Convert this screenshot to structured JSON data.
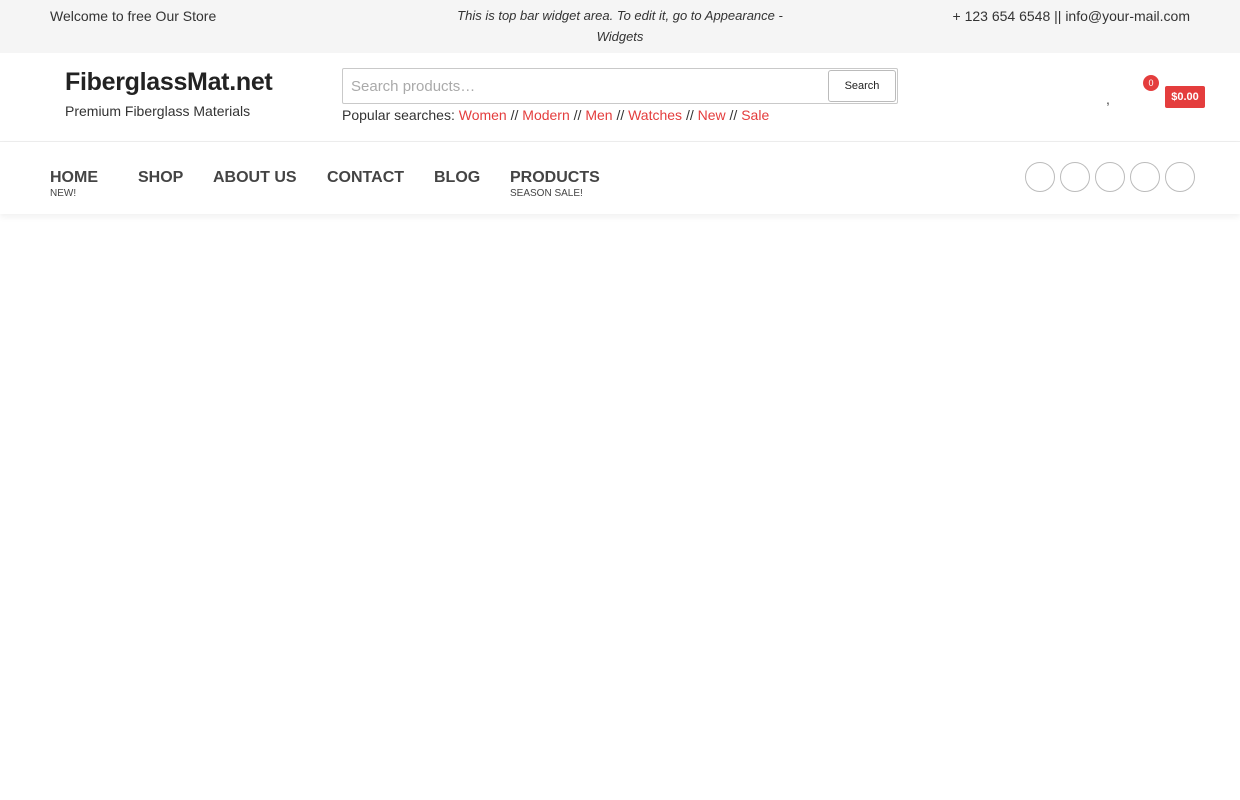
{
  "topbar": {
    "welcome": "Welcome to free Our Store",
    "widget_text": "This is top bar widget area. To edit it, go to Appearance - Widgets",
    "phone_glyph": "",
    "phone": "+ 123 654 6548 ||",
    "mail_glyph": "",
    "email": "info@your-mail.com"
  },
  "header": {
    "site_title": "FiberglassMat.net",
    "tagline": "Premium Fiberglass Materials",
    "search": {
      "placeholder": "Search products…",
      "button_label": "Search"
    },
    "popular_label": "Popular searches:",
    "popular_links": [
      "Women",
      "Modern",
      "Men",
      "Watches",
      "New",
      "Sale"
    ],
    "separator": "//",
    "icons": {
      "account_glyph": "",
      "wishlist_glyph": "",
      "cart_glyph": "",
      "comma": ","
    },
    "cart_count": "0",
    "cart_total": "$0.00"
  },
  "nav": {
    "items": [
      {
        "label": "HOME",
        "sub": "NEW!"
      },
      {
        "label": "SHOP"
      },
      {
        "label": "ABOUT US"
      },
      {
        "label": "CONTACT"
      },
      {
        "label": "BLOG"
      },
      {
        "label": "PRODUCTS",
        "sub": "SEASON SALE!"
      }
    ],
    "caret_glyph": "",
    "social_glyph": ""
  },
  "colors": {
    "accent": "#e43d3d",
    "topbar_bg": "#f5f5f5",
    "text": "#333333"
  }
}
